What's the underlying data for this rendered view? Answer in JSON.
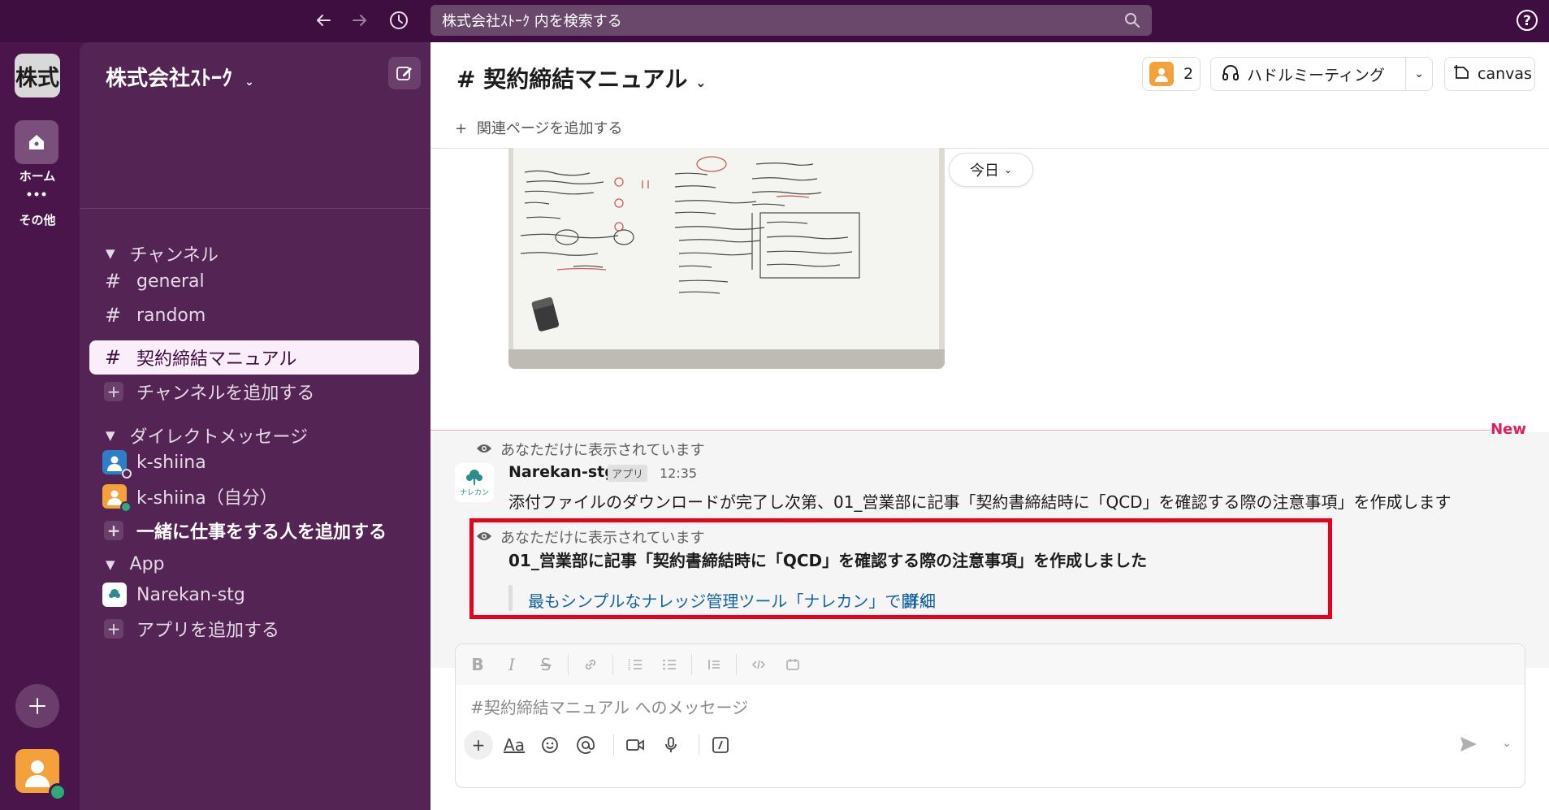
{
  "topbar": {
    "search_placeholder": "株式会社ｽﾄｰｸ 内を検索する"
  },
  "rail": {
    "workspace_tile": "株式",
    "home_label": "ホーム",
    "more_label": "その他"
  },
  "sidebar": {
    "workspace_name": "株式会社ｽﾄｰｸ",
    "channels_header": "チャンネル",
    "channels": [
      "general",
      "random",
      "契約締結マニュアル"
    ],
    "add_channel": "チャンネルを追加する",
    "dm_header": "ダイレクトメッセージ",
    "dms": [
      "k-shiina",
      "k-shiina（自分）"
    ],
    "add_coworker": "一緒に仕事をする人を追加する",
    "app_header": "App",
    "apps": [
      "Narekan-stg"
    ],
    "add_app": "アプリを追加する"
  },
  "header": {
    "channel_title": "契約締結マニュアル",
    "member_count": "2",
    "huddle_label": "ハドルミーティング",
    "canvas_label": "canvas",
    "add_related": "関連ページを追加する"
  },
  "messages": {
    "date_pill": "今日",
    "new_label": "New",
    "ephemeral_note": "あなただけに表示されています",
    "app_name": "Narekan-stg",
    "app_badge": "アプリ",
    "app_avatar_text": "ナレカン",
    "time": "12:35",
    "message1": "添付ファイルのダウンロードが完了し次第、01_営業部に記事「契約書締結時に「QCD」を確認する際の注意事項」を作成します",
    "message2": "01_営業部に記事「契約書締結時に「QCD」を確認する際の注意事項」を作成しました",
    "link_open": "最もシンプルなナレッジ管理ツール「ナレカン」で開く",
    "link_detail": "詳細"
  },
  "composer": {
    "placeholder": "#契約締結マニュアル へのメッセージ",
    "aa": "Aa"
  },
  "colors": {
    "sidebar_bg": "#532454",
    "topbar_bg": "#3f0e40",
    "link": "#1264a3",
    "highlight": "#e8001c",
    "new_marker": "#e01e5a"
  }
}
